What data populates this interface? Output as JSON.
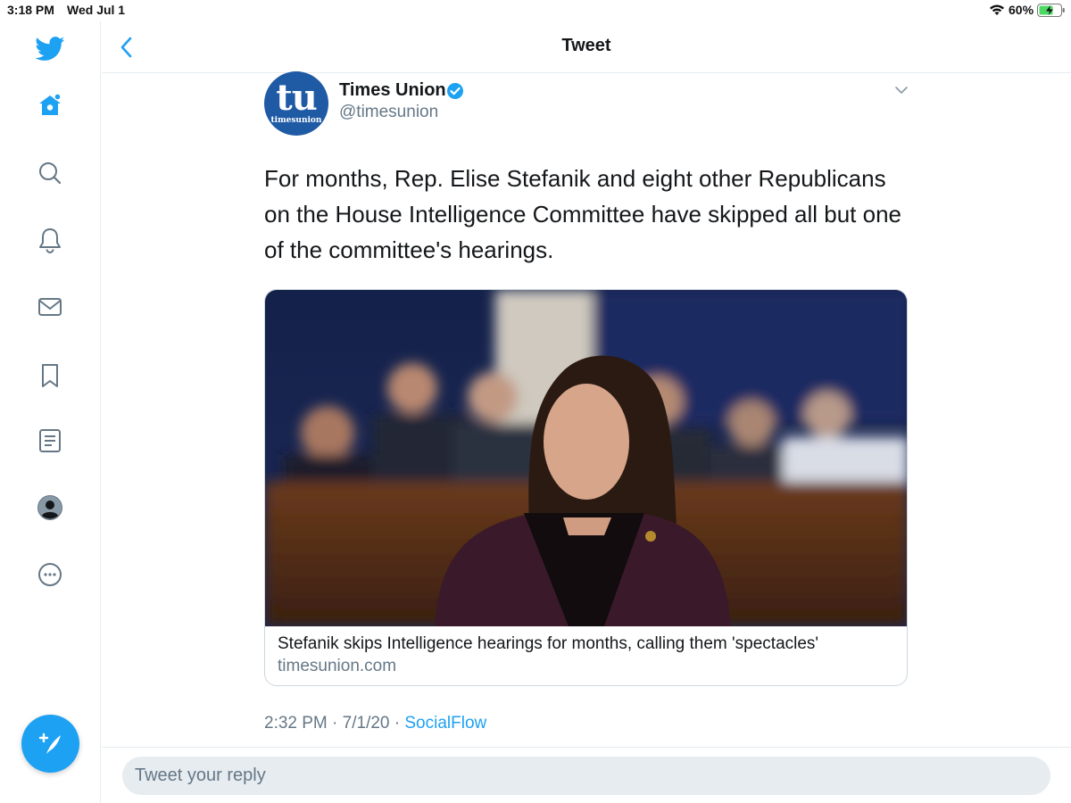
{
  "status_bar": {
    "time": "3:18 PM",
    "date": "Wed Jul 1",
    "battery_percent": "60%"
  },
  "colors": {
    "accent": "#1da1f2",
    "text_primary": "#14171a",
    "text_secondary": "#657786",
    "divider": "#e6ecf0"
  },
  "sidebar": {
    "items": [
      {
        "name": "twitter-logo-icon"
      },
      {
        "name": "home-icon"
      },
      {
        "name": "search-icon"
      },
      {
        "name": "notifications-bell-icon"
      },
      {
        "name": "messages-envelope-icon"
      },
      {
        "name": "bookmarks-icon"
      },
      {
        "name": "lists-icon"
      },
      {
        "name": "profile-icon"
      },
      {
        "name": "more-icon"
      }
    ],
    "compose_icon": "compose-tweet-icon"
  },
  "header": {
    "title": "Tweet"
  },
  "tweet": {
    "author": {
      "avatar_text": "tu",
      "avatar_subtext": "timesunion",
      "display_name": "Times Union",
      "handle": "@timesunion",
      "verified": true
    },
    "text": "For months, Rep. Elise Stefanik and eight other Republicans on the House Intelligence Committee have skipped all but one of the committee's hearings.",
    "card": {
      "title": "Stefanik skips Intelligence hearings for months, calling them 'spectacles'",
      "domain": "timesunion.com"
    },
    "time": "2:32 PM",
    "date": "7/1/20",
    "separator": "·",
    "source": "SocialFlow"
  },
  "reply": {
    "placeholder": "Tweet your reply"
  }
}
